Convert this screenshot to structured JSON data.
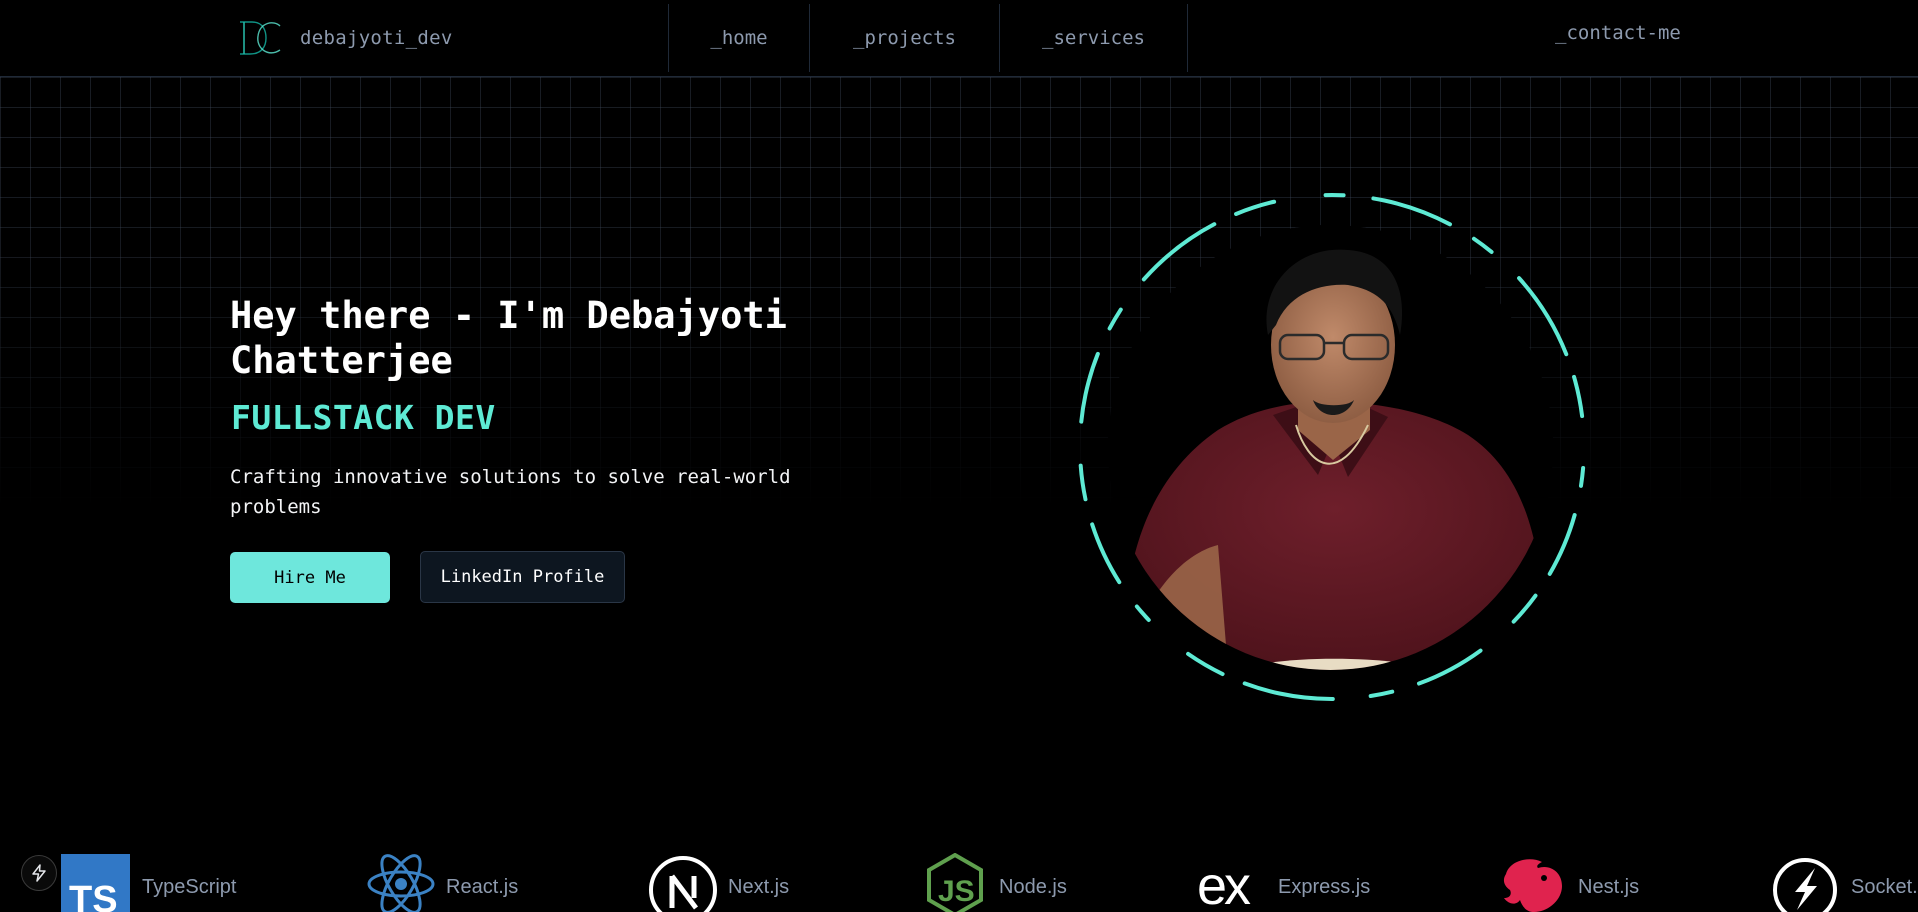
{
  "header": {
    "brand_text": "debajyoti_dev",
    "nav": [
      {
        "label": "_home"
      },
      {
        "label": "_projects"
      },
      {
        "label": "_services"
      }
    ],
    "contact_label": "_contact-me"
  },
  "hero": {
    "title": "Hey there - I'm Debajyoti Chatterjee",
    "role": "FULLSTACK DEV",
    "description": "Crafting innovative solutions to solve real-world problems",
    "hire_label": "Hire Me",
    "linkedin_label": "LinkedIn Profile"
  },
  "tech_stack": [
    {
      "name": "TypeScript",
      "icon": "typescript-icon"
    },
    {
      "name": "React.js",
      "icon": "react-icon"
    },
    {
      "name": "Next.js",
      "icon": "nextjs-icon"
    },
    {
      "name": "Node.js",
      "icon": "nodejs-icon"
    },
    {
      "name": "Express.js",
      "icon": "express-icon"
    },
    {
      "name": "Nest.js",
      "icon": "nestjs-icon"
    },
    {
      "name": "Socket.",
      "icon": "socketio-icon"
    }
  ],
  "colors": {
    "accent": "#5eead4",
    "button_bg": "#6ee7dc",
    "nav_text": "#8d9aae",
    "background": "#000000"
  }
}
